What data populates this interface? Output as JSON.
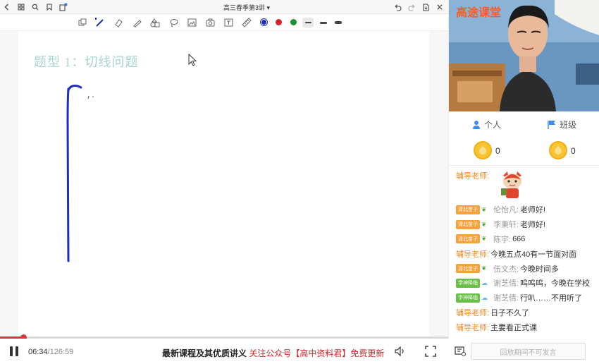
{
  "topbar": {
    "title": "高三春季第3讲 ▾",
    "left_icons": [
      "back-icon",
      "grid-icon",
      "search-icon",
      "bookmark-icon",
      "share-icon"
    ],
    "right_icons": [
      "undo-icon",
      "redo-icon",
      "export-icon",
      "close-icon"
    ]
  },
  "toolbar": {
    "tools": [
      "select-icon",
      "pen-icon",
      "eraser-icon",
      "marker-icon",
      "shapes-icon",
      "lasso-icon",
      "image-icon",
      "camera-icon",
      "text-icon",
      "ruler-icon"
    ],
    "colors": [
      "#1c2fbd",
      "#d8232a",
      "#1e8f2f"
    ],
    "line_widths": [
      "thin",
      "medium",
      "thick"
    ],
    "selected_color": "#1c2fbd"
  },
  "canvas": {
    "heading": "题型 1：切线问题"
  },
  "player": {
    "current_time": "06:34",
    "total_time": "/126:59",
    "progress_percent": 5.2,
    "overlay_prefix": "最新课程及其优质讲义",
    "overlay_red": "关注公众号【高中资料君】免费更新",
    "chat_placeholder": "回放期间不可发言"
  },
  "rpanel": {
    "brand": "高途课堂",
    "more": "···",
    "tabs": [
      {
        "icon": "person-icon",
        "label": "个人"
      },
      {
        "icon": "flag-icon",
        "label": "班级"
      }
    ],
    "coins": [
      "0",
      "0"
    ],
    "chat": [
      {
        "badge": "",
        "name": "辅导老师:",
        "tutor": true,
        "text": "",
        "sticker": true
      },
      {
        "badge": "清北苗子",
        "badge_color": "orange",
        "name": "伦怡凡:",
        "tutor": false,
        "text": "老师好!"
      },
      {
        "badge": "清北苗子",
        "badge_color": "orange",
        "name": "李秉轩:",
        "tutor": false,
        "text": "老师好!"
      },
      {
        "badge": "清北苗子",
        "badge_color": "orange",
        "name": "陈宇:",
        "tutor": false,
        "text": "666"
      },
      {
        "badge": "",
        "name": "辅导老师:",
        "tutor": true,
        "text": "今晚五点40有一节面对面"
      },
      {
        "badge": "清北苗子",
        "badge_color": "orange",
        "name": "伍文杰:",
        "tutor": false,
        "text": "今晚时间多"
      },
      {
        "badge": "学神降临",
        "badge_color": "green",
        "name": "谢芝倩:",
        "tutor": false,
        "text": "呜呜呜，今晚在学校"
      },
      {
        "badge": "学神降临",
        "badge_color": "green",
        "name": "谢芝倩:",
        "tutor": false,
        "text": "行叭……不用听了"
      },
      {
        "badge": "",
        "name": "辅导老师:",
        "tutor": true,
        "text": "日子不久了"
      },
      {
        "badge": "",
        "name": "辅导老师:",
        "tutor": true,
        "text": "主要看正式课"
      }
    ]
  }
}
